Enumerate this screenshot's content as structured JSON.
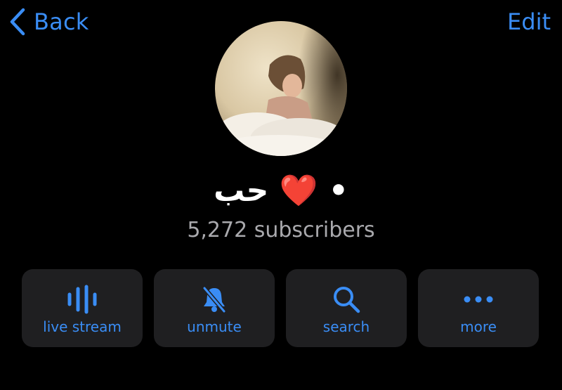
{
  "nav": {
    "back_label": "Back",
    "edit_label": "Edit",
    "accent_color": "#3a8df5"
  },
  "channel": {
    "name": "حب ❤️ •",
    "subscribers": "5,272 subscribers"
  },
  "actions": [
    {
      "label": "live stream",
      "icon": "waveform-icon"
    },
    {
      "label": "unmute",
      "icon": "bell-slash-icon"
    },
    {
      "label": "search",
      "icon": "magnifier-icon"
    },
    {
      "label": "more",
      "icon": "ellipsis-icon"
    }
  ]
}
